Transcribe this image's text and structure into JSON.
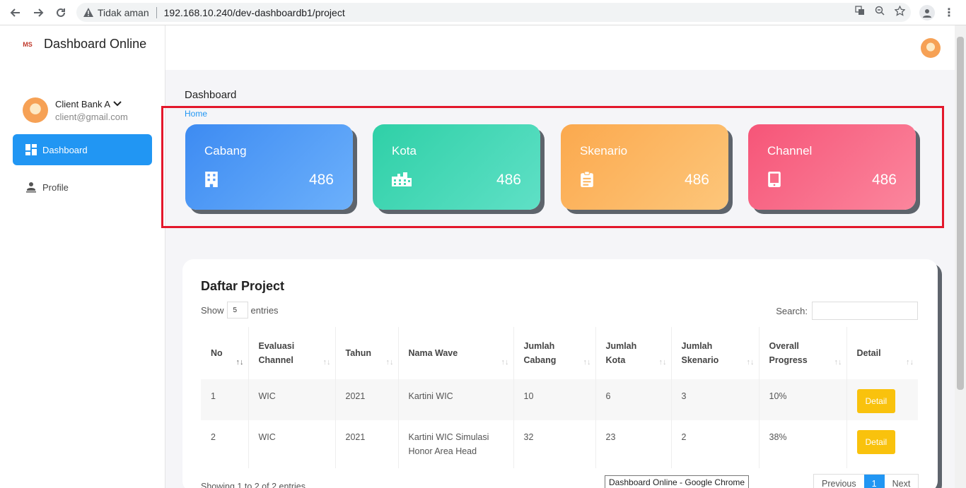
{
  "browser": {
    "security_label": "Tidak aman",
    "url": "192.168.10.240/dev-dashboardb1/project",
    "tooltip": "Dashboard Online - Google Chrome"
  },
  "sidebar": {
    "brand": "Dashboard Online",
    "logo_text": "MS",
    "user_name": "Client Bank A",
    "user_email": "client@gmail.com",
    "items": [
      {
        "label": "Dashboard",
        "icon": "dashboard-icon"
      },
      {
        "label": "Profile",
        "icon": "user-icon"
      }
    ]
  },
  "page": {
    "title": "Dashboard",
    "breadcrumb": "Home"
  },
  "stats": [
    {
      "label": "Cabang",
      "value": "486",
      "icon": "building-icon",
      "color": "#3d8bf2"
    },
    {
      "label": "Kota",
      "value": "486",
      "icon": "city-icon",
      "color": "#2fd0a7"
    },
    {
      "label": "Skenario",
      "value": "486",
      "icon": "clipboard-icon",
      "color": "#fba94e"
    },
    {
      "label": "Channel",
      "value": "486",
      "icon": "tablet-icon",
      "color": "#f65578"
    }
  ],
  "table": {
    "title": "Daftar Project",
    "show_label": "Show",
    "entries_value": "5",
    "entries_label": "entries",
    "search_label": "Search:",
    "headers": {
      "no": "No",
      "evaluasi_1": "Evaluasi",
      "evaluasi_2": "Channel",
      "tahun": "Tahun",
      "nama_wave": "Nama Wave",
      "jumlah_cabang_1": "Jumlah",
      "jumlah_cabang_2": "Cabang",
      "jumlah_kota_1": "Jumlah",
      "jumlah_kota_2": "Kota",
      "jumlah_skenario_1": "Jumlah",
      "jumlah_skenario_2": "Skenario",
      "progress_1": "Overall",
      "progress_2": "Progress",
      "detail": "Detail"
    },
    "rows": [
      {
        "no": "1",
        "channel": "WIC",
        "tahun": "2021",
        "wave_1": "Kartini WIC",
        "wave_2": "",
        "cabang": "10",
        "kota": "6",
        "skenario": "3",
        "progress": "10%",
        "detail": "Detail"
      },
      {
        "no": "2",
        "channel": "WIC",
        "tahun": "2021",
        "wave_1": "Kartini WIC Simulasi",
        "wave_2": "Honor Area Head",
        "cabang": "32",
        "kota": "23",
        "skenario": "2",
        "progress": "38%",
        "detail": "Detail"
      }
    ],
    "info": "Showing 1 to 2 of 2 entries",
    "pagination": {
      "previous": "Previous",
      "current": "1",
      "next": "Next"
    }
  },
  "colors": {
    "accent": "#2196f3",
    "highlight_border": "#e3172b",
    "detail_button": "#f9c20d"
  }
}
